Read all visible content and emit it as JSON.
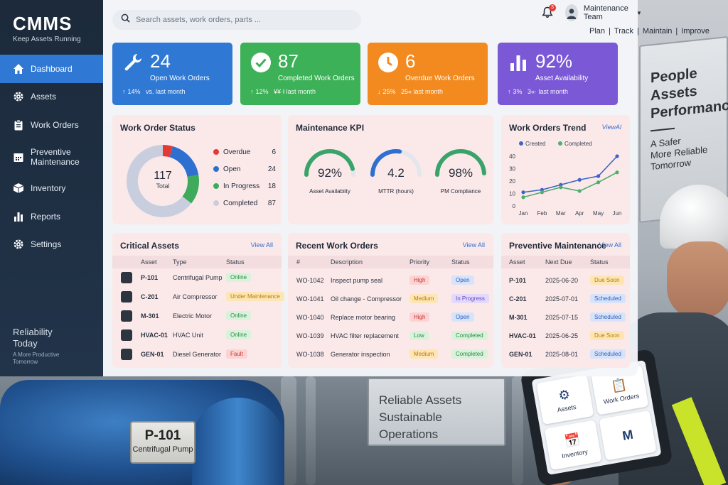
{
  "brand": {
    "name": "CMMS",
    "tagline": "Keep Assets Running"
  },
  "sidebar": {
    "items": [
      {
        "label": "Dashboard",
        "icon": "home-icon",
        "active": true
      },
      {
        "label": "Assets",
        "icon": "gear-icon"
      },
      {
        "label": "Work Orders",
        "icon": "clipboard-icon"
      },
      {
        "label": "Preventive Maintenance",
        "icon": "calendar-icon"
      },
      {
        "label": "Inventory",
        "icon": "box-icon"
      },
      {
        "label": "Reports",
        "icon": "bar-chart-icon"
      },
      {
        "label": "Settings",
        "icon": "gear-icon"
      }
    ],
    "footer_title": "Reliability Today",
    "footer_sub": "A More Productive Tomorrow"
  },
  "header": {
    "search_placeholder": "Search assets, work orders, parts ...",
    "notification_count": "3",
    "user_name": "Maintenance Team",
    "tagline": [
      "Plan",
      "Track",
      "Maintain",
      "Improve"
    ]
  },
  "stats": [
    {
      "value": "24",
      "label": "Open Work Orders",
      "change": "14%",
      "compare": "vs. last month",
      "color": "#2f78d4",
      "icon": "wrench-icon"
    },
    {
      "value": "87",
      "label": "Completed Work Orders",
      "change": "12%",
      "compare": "¥¥·ł last month",
      "color": "#3db157",
      "icon": "check-circle-icon"
    },
    {
      "value": "6",
      "label": "Overdue Work Orders",
      "change": "25%",
      "compare": "25« last month",
      "color": "#f28a1f",
      "icon": "clock-icon"
    },
    {
      "value": "92%",
      "label": "Asset Availability",
      "change": "3%",
      "compare": "3«· last month",
      "color": "#7b58d6",
      "icon": "bar-chart-icon"
    }
  ],
  "work_order_status": {
    "title": "Work Order Status",
    "total_value": "117",
    "total_label": "Total",
    "items": [
      {
        "label": "Overdue",
        "value": 6,
        "color": "#e53935"
      },
      {
        "label": "Open",
        "value": 24,
        "color": "#2f6fd0"
      },
      {
        "label": "In Progress",
        "value": 18,
        "color": "#3daa5c"
      },
      {
        "label": "Completed",
        "value": 87,
        "color": "#c9cede"
      }
    ]
  },
  "kpi": {
    "title": "Maintenance KPI",
    "gauges": [
      {
        "value": "92%",
        "label": "Asset Availabiity",
        "level": 0.92,
        "color": "#3aa36a"
      },
      {
        "value": "4.2",
        "label": "MTTR (hours)",
        "level": 0.55,
        "color": "#2f6fd0"
      },
      {
        "value": "98%",
        "label": "PM Compliance",
        "level": 0.98,
        "color": "#3aa36a"
      }
    ]
  },
  "chart_data": {
    "type": "line",
    "title": "Work Orders Trend",
    "view_all": "ViewAl",
    "categories": [
      "Jan",
      "Feb",
      "Mar",
      "Apr",
      "May",
      "Jun"
    ],
    "ylim": [
      0,
      40
    ],
    "yticks": [
      "0",
      "10",
      "20",
      "30",
      "40"
    ],
    "legend_position": "top-left",
    "series": [
      {
        "name": "Created",
        "color": "#3f63c6",
        "values": [
          11,
          13,
          17,
          21,
          24,
          40
        ]
      },
      {
        "name": "Completed",
        "color": "#4fae6e",
        "values": [
          7,
          11,
          15,
          12,
          19,
          27
        ]
      }
    ]
  },
  "critical_assets": {
    "title": "Critical Assets",
    "view_all": "View All",
    "columns": [
      "Asset",
      "Type",
      "Status"
    ],
    "rows": [
      {
        "asset": "P-101",
        "type": "Centrifugal Pump",
        "status": "Online",
        "status_bg": "#d8f2dc",
        "status_fg": "#2f8a45"
      },
      {
        "asset": "C-201",
        "type": "Air Compressor",
        "status": "Under Maintenance",
        "status_bg": "#fde6b3",
        "status_fg": "#b97a10"
      },
      {
        "asset": "M-301",
        "type": "Electric Motor",
        "status": "Online",
        "status_bg": "#d8f2dc",
        "status_fg": "#2f8a45"
      },
      {
        "asset": "HVAC-01",
        "type": "HVAC Unit",
        "status": "Online",
        "status_bg": "#d8f2dc",
        "status_fg": "#2f8a45"
      },
      {
        "asset": "GEN-01",
        "type": "Diesel Generator",
        "status": "Fault",
        "status_bg": "#fbd3d3",
        "status_fg": "#c93636"
      }
    ]
  },
  "recent_work_orders": {
    "title": "Recent Work Orders",
    "view_all": "View All",
    "columns": [
      "#",
      "Description",
      "Priority",
      "Status"
    ],
    "rows": [
      {
        "id": "WO-1042",
        "desc": "Inspect pump seal",
        "priority": "High",
        "status": "Open"
      },
      {
        "id": "WO-1041",
        "desc": "Oil change - Compressor",
        "priority": "Medium",
        "status": "In Progress"
      },
      {
        "id": "WO-1040",
        "desc": "Replace motor bearing",
        "priority": "High",
        "status": "Open"
      },
      {
        "id": "WO-1039",
        "desc": "HVAC filter replacement",
        "priority": "Low",
        "status": "Completed"
      },
      {
        "id": "WO-1038",
        "desc": "Generator inspection",
        "priority": "Medium",
        "status": "Completed"
      }
    ],
    "priority_colors": {
      "High": [
        "#fbd3d3",
        "#c93636"
      ],
      "Medium": [
        "#fde6b3",
        "#b97a10"
      ],
      "Low": [
        "#d8f2dc",
        "#2f8a45"
      ]
    },
    "status_colors": {
      "Open": [
        "#d6e3fb",
        "#2f5fb8"
      ],
      "In Progress": [
        "#e2d9fb",
        "#6a46c2"
      ],
      "Completed": [
        "#d8f2dc",
        "#2f8a45"
      ]
    }
  },
  "preventive_maintenance": {
    "title": "Preventive Maintenance",
    "view_all": "View All",
    "columns": [
      "Asset",
      "Next Due",
      "Status"
    ],
    "rows": [
      {
        "asset": "P-101",
        "due": "2025-06-20",
        "status": "Due Soon"
      },
      {
        "asset": "C-201",
        "due": "2025-07-01",
        "status": "Scheduled"
      },
      {
        "asset": "M-301",
        "due": "2025-07-15",
        "status": "Scheduled"
      },
      {
        "asset": "HVAC-01",
        "due": "2025-06-25",
        "status": "Due Soon"
      },
      {
        "asset": "GEN-01",
        "due": "2025-08-01",
        "status": "Scheduled"
      }
    ],
    "status_colors": {
      "Due Soon": [
        "#fde6b3",
        "#b97a10"
      ],
      "Scheduled": [
        "#d6e3fb",
        "#2f5fb8"
      ]
    }
  },
  "scene": {
    "pump_plate_id": "P-101",
    "pump_plate_name": "Centrifugal Pump",
    "sign_mid": [
      "Reliable Assets",
      "Sustainable Operations"
    ],
    "sign_right_title": [
      "People",
      "Assets",
      "Performance"
    ],
    "sign_right_sub": [
      "A Safer",
      "More Reliable",
      "Tomorrow"
    ],
    "tablet_tiles": [
      {
        "label": "Assets",
        "icon": "gear-icon"
      },
      {
        "label": "Work Orders",
        "icon": "clipboard-icon"
      },
      {
        "label": "Inventory",
        "icon": "calendar-icon"
      },
      {
        "label": "",
        "icon": "chart-icon"
      }
    ]
  }
}
